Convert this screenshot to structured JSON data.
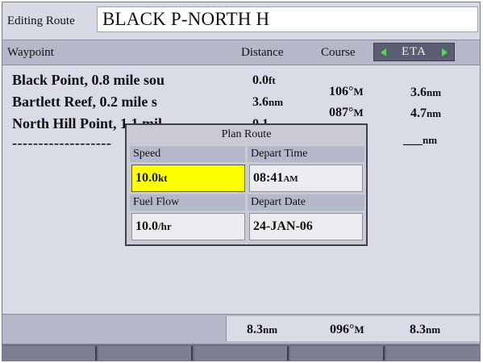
{
  "header": {
    "label": "Editing Route",
    "route_name": "BLACK P-NORTH H"
  },
  "columns": {
    "waypoint": "Waypoint",
    "distance": "Distance",
    "course": "Course",
    "eta": "ETA"
  },
  "rows": [
    {
      "name": "Black Point, 0.8 mile sou",
      "distance": "0.0",
      "distance_unit": "ft",
      "course": "",
      "eta": ""
    },
    {
      "name": "Bartlett Reef, 0.2 mile s",
      "distance": "3.6",
      "distance_unit": "nm",
      "course": "106°",
      "course_unit": "M",
      "eta": "3.6",
      "eta_unit": "nm"
    },
    {
      "name": "North Hill Point, 1.1 mil",
      "distance": "0.1",
      "distance_unit": "",
      "course": "087°",
      "course_unit": "M",
      "eta": "4.7",
      "eta_unit": "nm"
    },
    {
      "name": "-------------------",
      "distance": "",
      "course": "",
      "eta": "___",
      "eta_unit": "nm"
    }
  ],
  "plan_route": {
    "title": "Plan Route",
    "speed_label": "Speed",
    "speed_value": "10.0",
    "speed_unit": "kt",
    "depart_time_label": "Depart Time",
    "depart_time_value": "08:41",
    "depart_time_suffix": "AM",
    "fuel_flow_label": "Fuel Flow",
    "fuel_flow_value": "10.0",
    "fuel_flow_unit": "/hr",
    "depart_date_label": "Depart Date",
    "depart_date_value": "24-JAN-06"
  },
  "totals": {
    "distance": "8.3",
    "distance_unit": "nm",
    "course": "096°",
    "course_unit": "M",
    "eta": "8.3",
    "eta_unit": "nm"
  },
  "colors": {
    "highlight": "#ffff00",
    "arrow": "#5bd25b",
    "eta_box": "#5b5e72",
    "header_band": "#b5b8c9"
  },
  "icons": [
    "left-arrow-icon",
    "right-arrow-icon"
  ]
}
